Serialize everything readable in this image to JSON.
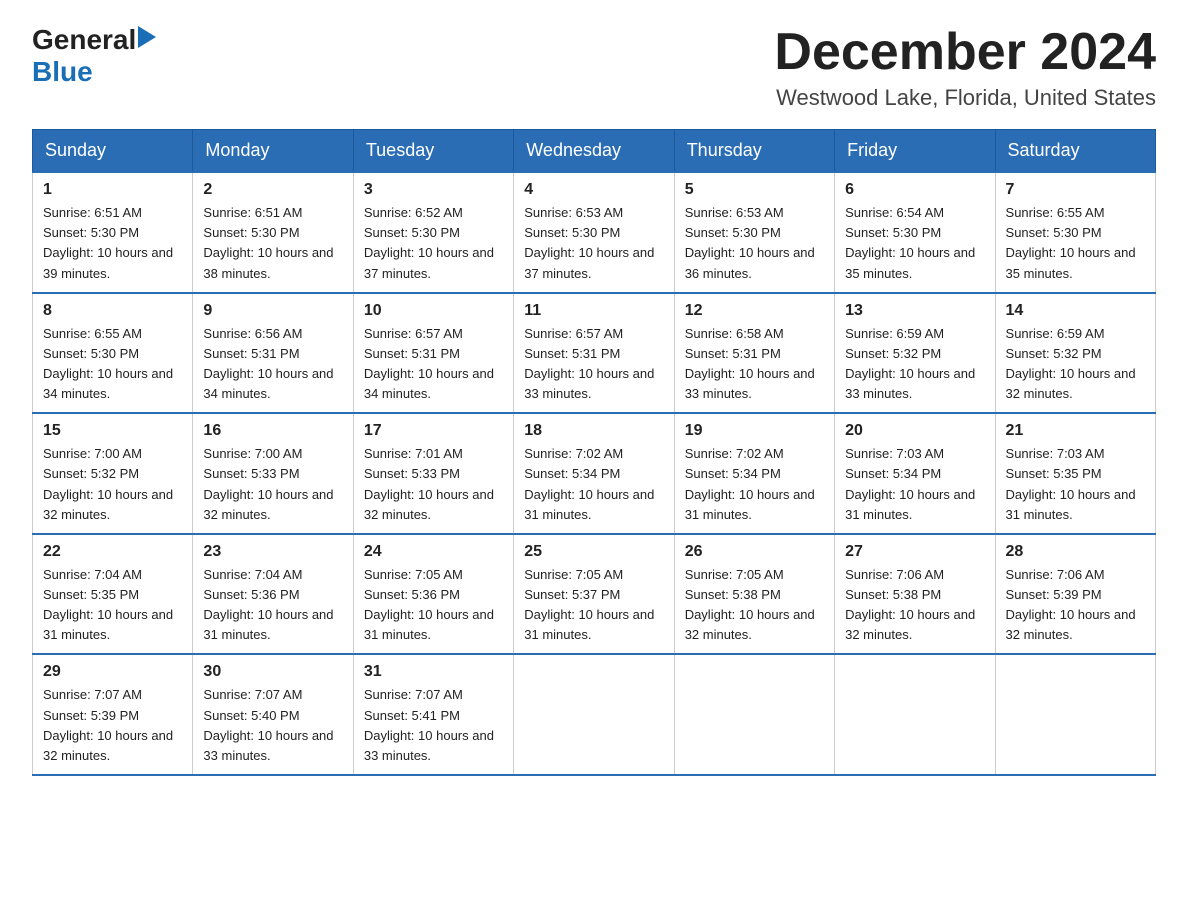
{
  "header": {
    "logo_general": "General",
    "logo_arrow": "▶",
    "logo_blue": "Blue",
    "month_title": "December 2024",
    "location": "Westwood Lake, Florida, United States"
  },
  "weekdays": [
    "Sunday",
    "Monday",
    "Tuesday",
    "Wednesday",
    "Thursday",
    "Friday",
    "Saturday"
  ],
  "weeks": [
    [
      {
        "day": "1",
        "sunrise": "6:51 AM",
        "sunset": "5:30 PM",
        "daylight": "10 hours and 39 minutes."
      },
      {
        "day": "2",
        "sunrise": "6:51 AM",
        "sunset": "5:30 PM",
        "daylight": "10 hours and 38 minutes."
      },
      {
        "day": "3",
        "sunrise": "6:52 AM",
        "sunset": "5:30 PM",
        "daylight": "10 hours and 37 minutes."
      },
      {
        "day": "4",
        "sunrise": "6:53 AM",
        "sunset": "5:30 PM",
        "daylight": "10 hours and 37 minutes."
      },
      {
        "day": "5",
        "sunrise": "6:53 AM",
        "sunset": "5:30 PM",
        "daylight": "10 hours and 36 minutes."
      },
      {
        "day": "6",
        "sunrise": "6:54 AM",
        "sunset": "5:30 PM",
        "daylight": "10 hours and 35 minutes."
      },
      {
        "day": "7",
        "sunrise": "6:55 AM",
        "sunset": "5:30 PM",
        "daylight": "10 hours and 35 minutes."
      }
    ],
    [
      {
        "day": "8",
        "sunrise": "6:55 AM",
        "sunset": "5:30 PM",
        "daylight": "10 hours and 34 minutes."
      },
      {
        "day": "9",
        "sunrise": "6:56 AM",
        "sunset": "5:31 PM",
        "daylight": "10 hours and 34 minutes."
      },
      {
        "day": "10",
        "sunrise": "6:57 AM",
        "sunset": "5:31 PM",
        "daylight": "10 hours and 34 minutes."
      },
      {
        "day": "11",
        "sunrise": "6:57 AM",
        "sunset": "5:31 PM",
        "daylight": "10 hours and 33 minutes."
      },
      {
        "day": "12",
        "sunrise": "6:58 AM",
        "sunset": "5:31 PM",
        "daylight": "10 hours and 33 minutes."
      },
      {
        "day": "13",
        "sunrise": "6:59 AM",
        "sunset": "5:32 PM",
        "daylight": "10 hours and 33 minutes."
      },
      {
        "day": "14",
        "sunrise": "6:59 AM",
        "sunset": "5:32 PM",
        "daylight": "10 hours and 32 minutes."
      }
    ],
    [
      {
        "day": "15",
        "sunrise": "7:00 AM",
        "sunset": "5:32 PM",
        "daylight": "10 hours and 32 minutes."
      },
      {
        "day": "16",
        "sunrise": "7:00 AM",
        "sunset": "5:33 PM",
        "daylight": "10 hours and 32 minutes."
      },
      {
        "day": "17",
        "sunrise": "7:01 AM",
        "sunset": "5:33 PM",
        "daylight": "10 hours and 32 minutes."
      },
      {
        "day": "18",
        "sunrise": "7:02 AM",
        "sunset": "5:34 PM",
        "daylight": "10 hours and 31 minutes."
      },
      {
        "day": "19",
        "sunrise": "7:02 AM",
        "sunset": "5:34 PM",
        "daylight": "10 hours and 31 minutes."
      },
      {
        "day": "20",
        "sunrise": "7:03 AM",
        "sunset": "5:34 PM",
        "daylight": "10 hours and 31 minutes."
      },
      {
        "day": "21",
        "sunrise": "7:03 AM",
        "sunset": "5:35 PM",
        "daylight": "10 hours and 31 minutes."
      }
    ],
    [
      {
        "day": "22",
        "sunrise": "7:04 AM",
        "sunset": "5:35 PM",
        "daylight": "10 hours and 31 minutes."
      },
      {
        "day": "23",
        "sunrise": "7:04 AM",
        "sunset": "5:36 PM",
        "daylight": "10 hours and 31 minutes."
      },
      {
        "day": "24",
        "sunrise": "7:05 AM",
        "sunset": "5:36 PM",
        "daylight": "10 hours and 31 minutes."
      },
      {
        "day": "25",
        "sunrise": "7:05 AM",
        "sunset": "5:37 PM",
        "daylight": "10 hours and 31 minutes."
      },
      {
        "day": "26",
        "sunrise": "7:05 AM",
        "sunset": "5:38 PM",
        "daylight": "10 hours and 32 minutes."
      },
      {
        "day": "27",
        "sunrise": "7:06 AM",
        "sunset": "5:38 PM",
        "daylight": "10 hours and 32 minutes."
      },
      {
        "day": "28",
        "sunrise": "7:06 AM",
        "sunset": "5:39 PM",
        "daylight": "10 hours and 32 minutes."
      }
    ],
    [
      {
        "day": "29",
        "sunrise": "7:07 AM",
        "sunset": "5:39 PM",
        "daylight": "10 hours and 32 minutes."
      },
      {
        "day": "30",
        "sunrise": "7:07 AM",
        "sunset": "5:40 PM",
        "daylight": "10 hours and 33 minutes."
      },
      {
        "day": "31",
        "sunrise": "7:07 AM",
        "sunset": "5:41 PM",
        "daylight": "10 hours and 33 minutes."
      },
      null,
      null,
      null,
      null
    ]
  ]
}
